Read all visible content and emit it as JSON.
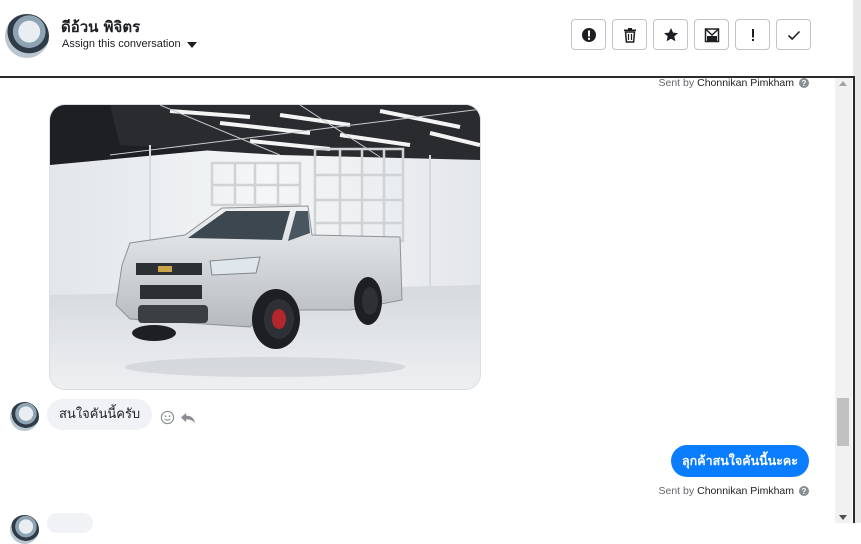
{
  "contact": {
    "name": "ดีอ้วน พิจิตร",
    "assign_label": "Assign this conversation"
  },
  "toolbar": {
    "buttons": [
      {
        "icon": "alert-circle-icon"
      },
      {
        "icon": "trash-icon"
      },
      {
        "icon": "star-icon"
      },
      {
        "icon": "mark-unread-icon"
      },
      {
        "icon": "exclamation-icon"
      },
      {
        "icon": "check-icon"
      }
    ]
  },
  "messages": {
    "sent_by_prefix": "Sent by",
    "agent_name": "Chonnikan Pimkham",
    "incoming_text": "สนใจคันนี้ครับ",
    "outgoing_text": "ลุกค้าสนใจคันนี้นะคะ"
  },
  "colors": {
    "outgoing_bubble": "#0a7cff",
    "incoming_bubble": "#f0f2f5"
  }
}
